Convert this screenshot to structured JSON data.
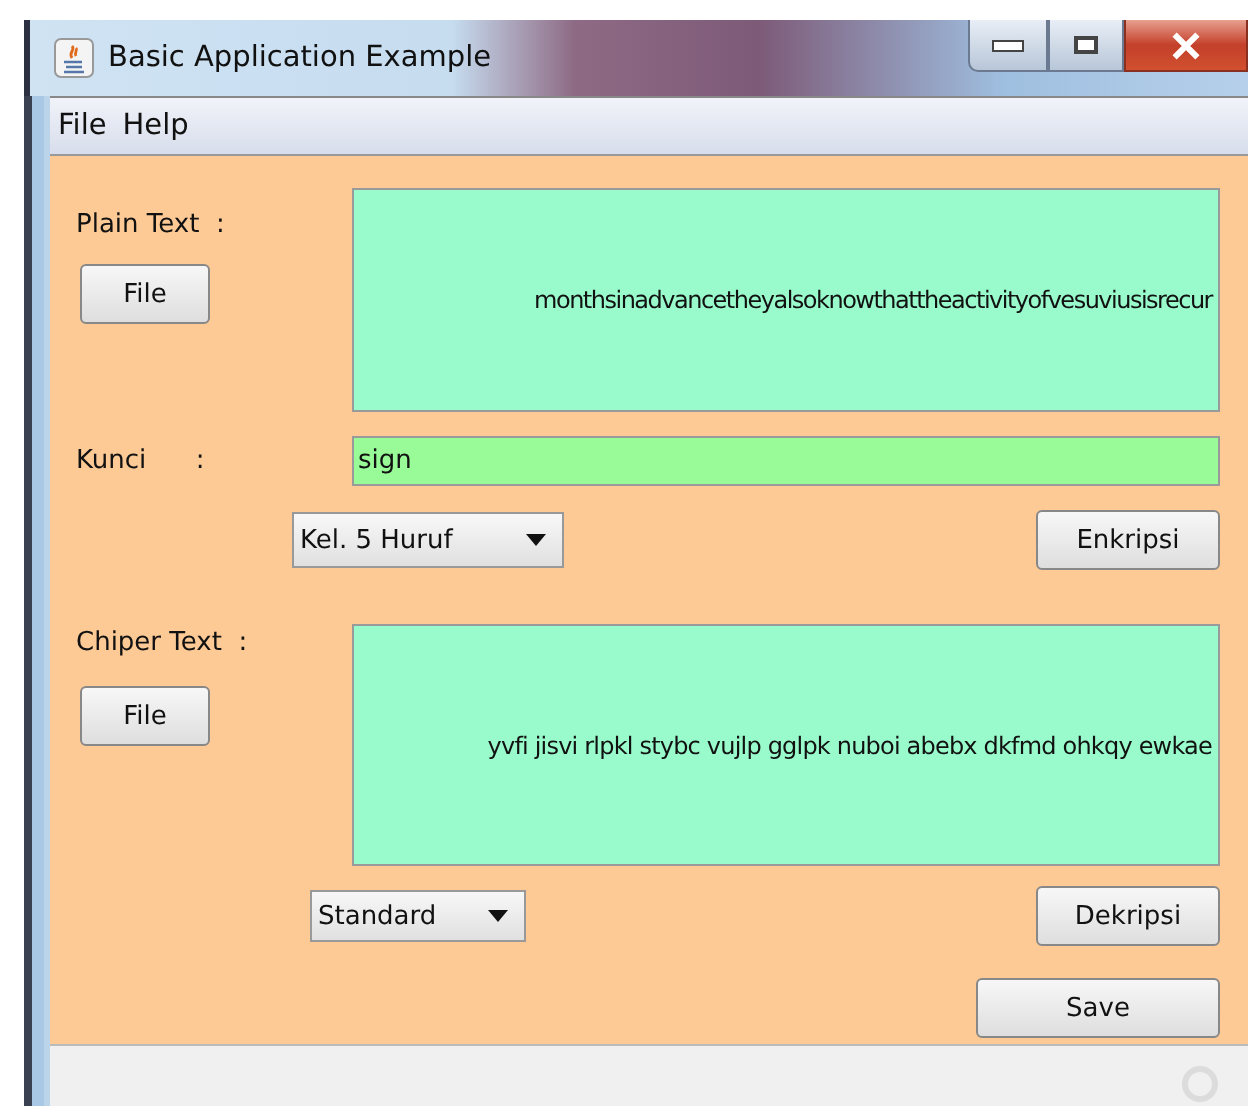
{
  "window": {
    "title": "Basic Application Example"
  },
  "menu": [
    {
      "label": "File"
    },
    {
      "label": "Help"
    }
  ],
  "plain_text": {
    "label": "Plain Text  :",
    "file_button": "File",
    "value": "monthsinadvancetheyalsoknowthattheactivityofvesuviusisrecur"
  },
  "key": {
    "label": "Kunci      :",
    "value": "sign"
  },
  "grouping": {
    "value": "Kel. 5 Huruf"
  },
  "encrypt_button": "Enkripsi",
  "cipher_text": {
    "label": "Chiper Text  :",
    "file_button": "File",
    "value": "yvfi jisvi rlpkl stybc vujlp gglpk nuboi abebx dkfmd ohkqy ewkae"
  },
  "format": {
    "value": "Standard"
  },
  "decrypt_button": "Dekripsi",
  "save_button": "Save"
}
